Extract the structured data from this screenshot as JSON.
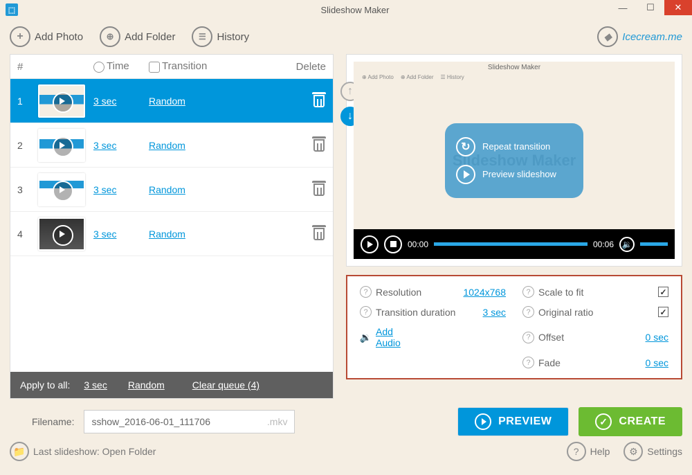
{
  "app_title": "Slideshow Maker",
  "toolbar": {
    "add_photo": "Add Photo",
    "add_folder": "Add Folder",
    "history": "History",
    "brand": "Icecream.me"
  },
  "slides_table": {
    "headers": {
      "num": "#",
      "time": "Time",
      "transition": "Transition",
      "delete": "Delete"
    },
    "rows": [
      {
        "num": "1",
        "time": "3 sec",
        "transition": "Random",
        "selected": true
      },
      {
        "num": "2",
        "time": "3 sec",
        "transition": "Random",
        "selected": false
      },
      {
        "num": "3",
        "time": "3 sec",
        "transition": "Random",
        "selected": false
      },
      {
        "num": "4",
        "time": "3 sec",
        "transition": "Random",
        "selected": false
      }
    ],
    "apply_all": {
      "label": "Apply to all:",
      "time": "3 sec",
      "transition": "Random",
      "clear_queue": "Clear queue  (4)"
    }
  },
  "preview": {
    "popup": {
      "repeat": "Repeat transition",
      "play": "Preview slideshow"
    },
    "time_start": "00:00",
    "time_end": "00:06",
    "mini_title": "Slideshow Maker"
  },
  "settings": {
    "resolution_label": "Resolution",
    "resolution_value": "1024x768",
    "transition_label": "Transition duration",
    "transition_value": "3 sec",
    "add_audio": "Add Audio",
    "scale_label": "Scale to fit",
    "ratio_label": "Original ratio",
    "offset_label": "Offset",
    "offset_value": "0 sec",
    "fade_label": "Fade",
    "fade_value": "0 sec"
  },
  "filename": {
    "label": "Filename:",
    "value": "sshow_2016-06-01_111706",
    "ext": ".mkv"
  },
  "buttons": {
    "preview": "PREVIEW",
    "create": "CREATE"
  },
  "status": {
    "last": "Last slideshow: Open Folder",
    "help": "Help",
    "settings": "Settings"
  }
}
